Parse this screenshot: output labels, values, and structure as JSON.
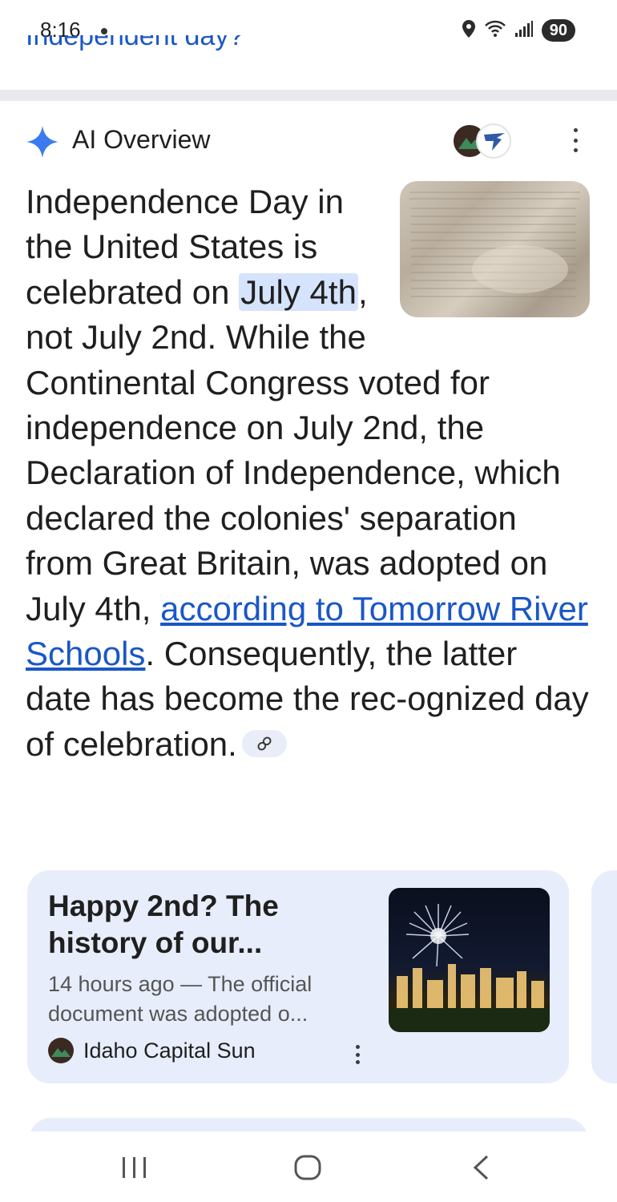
{
  "status_bar": {
    "time": "8:16",
    "battery": "90"
  },
  "query_cutoff": "Independent day?",
  "ai_overview": {
    "header_label": "AI Overview",
    "text": {
      "p1": "Independence Day in the United States is celebrated on ",
      "highlight": "July 4th",
      "p2": ", not July 2nd. While the Continental Congress voted for independence on July 2nd, the Declaration of Independence, which declared the colonies' separation from Great Britain, was adopted on July 4th, ",
      "link": "according to Tomorrow River Schools",
      "p3": ". Consequently, the latter date has become the rec-ognized day of celebration."
    }
  },
  "result_card": {
    "title": "Happy 2nd? The history of our...",
    "snippet": "14 hours ago — The official document was adopted o...",
    "source": "Idaho Capital Sun"
  },
  "accent_color": "#1a57c7",
  "highlight_color": "#d5e3fc"
}
